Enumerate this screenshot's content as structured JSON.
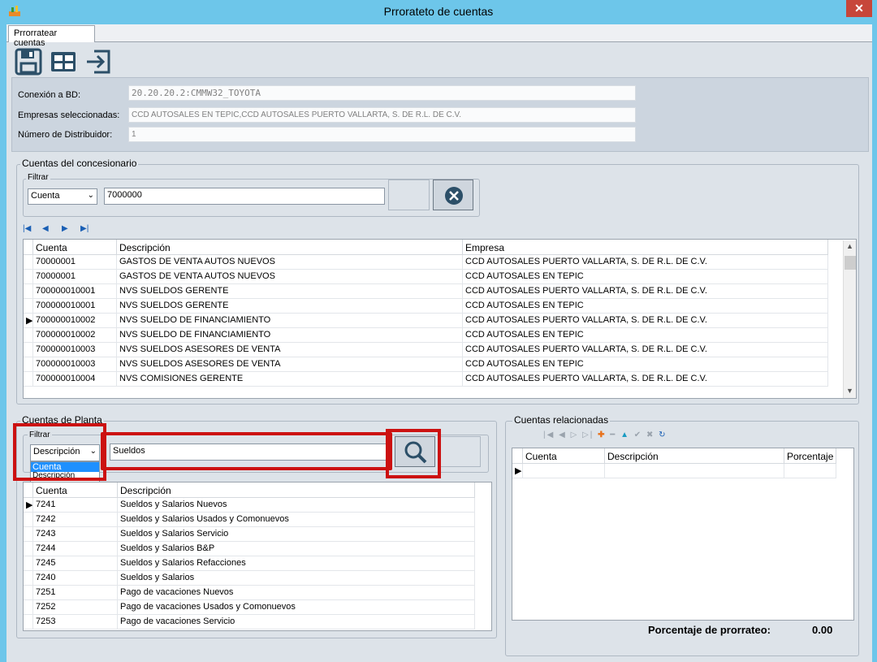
{
  "window": {
    "title": "Prrorateto de cuentas",
    "close": "✕"
  },
  "tab": "Prrorratear cuentas",
  "toolbar": [
    "save-icon",
    "grid-icon",
    "exit-icon"
  ],
  "header": {
    "conexion_label": "Conexión a BD:",
    "conexion_value": "20.20.20.2:CMMW32_TOYOTA",
    "empresas_label": "Empresas seleccionadas:",
    "empresas_value": "CCD AUTOSALES EN TEPIC,CCD AUTOSALES PUERTO VALLARTA, S. DE R.L. DE C.V.",
    "distribuidor_label": "Número de Distribuidor:",
    "distribuidor_value": "1"
  },
  "concesionario": {
    "title": "Cuentas del concesionario",
    "filter_label": "Filtrar",
    "filter_field": "Cuenta",
    "filter_value": "7000000",
    "columns": [
      "Cuenta",
      "Descripción",
      "Empresa"
    ],
    "rows": [
      [
        "70000001",
        "GASTOS DE VENTA AUTOS NUEVOS",
        "CCD AUTOSALES PUERTO VALLARTA, S. DE R.L. DE C.V."
      ],
      [
        "70000001",
        "GASTOS DE VENTA AUTOS NUEVOS",
        "CCD AUTOSALES EN TEPIC"
      ],
      [
        "700000010001",
        "NVS SUELDOS GERENTE",
        "CCD AUTOSALES PUERTO VALLARTA, S. DE R.L. DE C.V."
      ],
      [
        "700000010001",
        "NVS SUELDOS GERENTE",
        "CCD AUTOSALES EN TEPIC"
      ],
      [
        "700000010002",
        "NVS SUELDO DE FINANCIAMIENTO",
        "CCD AUTOSALES PUERTO VALLARTA, S. DE R.L. DE C.V."
      ],
      [
        "700000010002",
        "NVS SUELDO DE FINANCIAMIENTO",
        "CCD AUTOSALES EN TEPIC"
      ],
      [
        "700000010003",
        "NVS SUELDOS ASESORES DE VENTA",
        "CCD AUTOSALES PUERTO VALLARTA, S. DE R.L. DE C.V."
      ],
      [
        "700000010003",
        "NVS SUELDOS ASESORES DE VENTA",
        "CCD AUTOSALES EN TEPIC"
      ],
      [
        "700000010004",
        "NVS COMISIONES GERENTE",
        "CCD AUTOSALES PUERTO VALLARTA, S. DE R.L. DE C.V."
      ]
    ]
  },
  "planta": {
    "title": "Cuentas de Planta",
    "filter_label": "Filtrar",
    "filter_field": "Descripción",
    "dropdown_options": [
      "Cuenta",
      "Descripción"
    ],
    "filter_value": "Sueldos",
    "columns": [
      "Cuenta",
      "Descripción"
    ],
    "rows": [
      [
        "7241",
        "Sueldos y Salarios  Nuevos"
      ],
      [
        "7242",
        "Sueldos y Salarios  Usados y Comonuevos"
      ],
      [
        "7243",
        "Sueldos y Salarios  Servicio"
      ],
      [
        "7244",
        "Sueldos y Salarios  B&P"
      ],
      [
        "7245",
        "Sueldos y Salarios  Refacciones"
      ],
      [
        "7240",
        "Sueldos y Salarios"
      ],
      [
        "7251",
        "Pago de vacaciones  Nuevos"
      ],
      [
        "7252",
        "Pago de vacaciones  Usados y Comonuevos"
      ],
      [
        "7253",
        "Pago de vacaciones  Servicio"
      ]
    ]
  },
  "relacionadas": {
    "title": "Cuentas relacionadas",
    "columns": [
      "Cuenta",
      "Descripción",
      "Porcentaje"
    ],
    "footer_label": "Porcentaje de prorrateo:",
    "footer_value": "0.00"
  }
}
